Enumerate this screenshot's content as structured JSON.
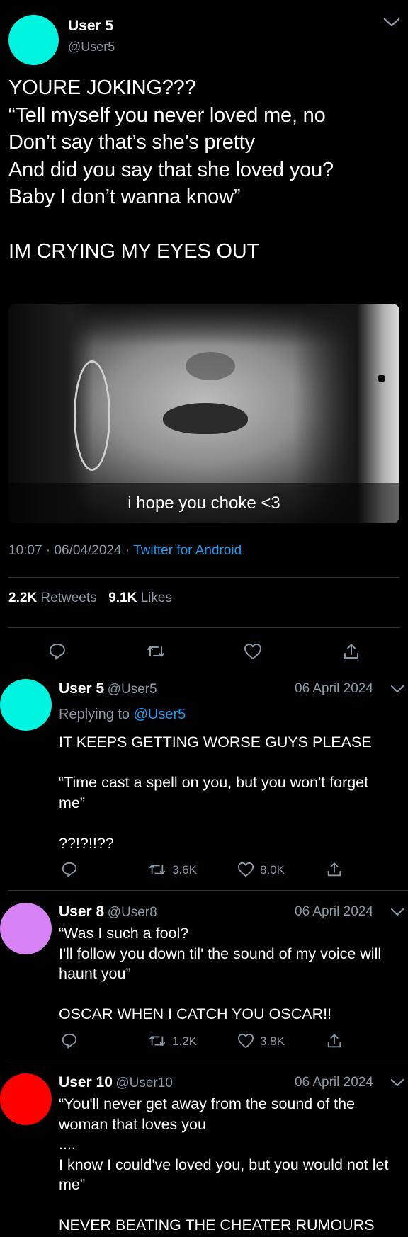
{
  "main_tweet": {
    "name": "User 5",
    "handle": "@User5",
    "avatar_color": "#00f5e0",
    "text": "YOURE JOKING???\n“Tell myself you never loved me, no\nDon’t say that’s she’s pretty\nAnd did you say that she loved you?\nBaby I don’t wanna know”\n\nIM CRYING MY EYES OUT",
    "image_caption": "i hope you choke <3",
    "time": "10:07",
    "date": "06/04/2024",
    "source": "Twitter for Android",
    "retweets_count": "2.2K",
    "retweets_label": "Retweets",
    "likes_count": "9.1K",
    "likes_label": "Likes"
  },
  "replies": [
    {
      "name": "User 5",
      "handle": "@User5",
      "date": "06 April 2024",
      "avatar_color": "#00f5e0",
      "replying_label": "Replying to",
      "replying_to": "@User5",
      "text": "IT KEEPS GETTING WORSE GUYS PLEASE\n\n“Time cast a spell on you, but you won't forget me”\n\n??!?!!??",
      "retweets": "3.6K",
      "likes": "8.0K"
    },
    {
      "name": "User 8",
      "handle": "@User8",
      "date": "06 April 2024",
      "avatar_color": "#d782f5",
      "text": "“Was I such a fool?\nI'll follow you down til' the sound of my voice will haunt you”\n\nOSCAR WHEN I CATCH YOU OSCAR!!",
      "retweets": "1.2K",
      "likes": "3.8K"
    },
    {
      "name": "User 10",
      "handle": "@User10",
      "date": "06 April 2024",
      "avatar_color": "#ff0000",
      "text": "“You'll never get away from the sound of the woman that loves you\n....\nI know I could've loved you, but you would not let me”\n\nNEVER BEATING THE CHEATER RUMOURS"
    }
  ],
  "colors": {
    "background": "#000000",
    "link": "#1d9bf0",
    "muted": "#8b98a5",
    "divider": "#2f3336"
  }
}
